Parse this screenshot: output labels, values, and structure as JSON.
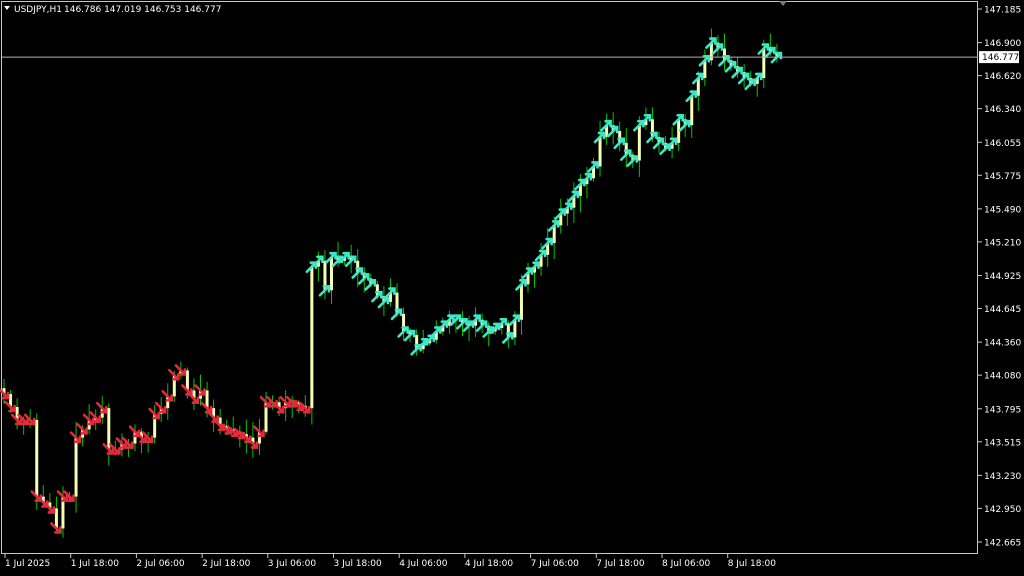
{
  "header": {
    "symbol_text": "USDJPY,H1",
    "ohlc_text": "146.786 147.019 146.753 146.777"
  },
  "colors": {
    "background": "#000000",
    "frame": "#c8c8c8",
    "text": "#ffffff",
    "candle_wick": "#00c800",
    "candle_body": "#f5ffb4",
    "up_arrow": "#3ee6c8",
    "down_arrow": "#e6283c",
    "price_line": "#b0b0b0",
    "last_price_bg": "#ffffff",
    "last_price_text": "#000000"
  },
  "chart_data": {
    "type": "candlestick",
    "symbol": "USDJPY",
    "timeframe": "H1",
    "last_price": 146.777,
    "y_ticks": [
      "147.185",
      "146.900",
      "146.620",
      "146.340",
      "146.055",
      "145.775",
      "145.490",
      "145.210",
      "144.925",
      "144.645",
      "144.360",
      "144.080",
      "143.795",
      "143.515",
      "143.230",
      "142.950",
      "142.665"
    ],
    "x_ticks": [
      "1 Jul 2025",
      "1 Jul 18:00",
      "2 Jul 06:00",
      "2 Jul 18:00",
      "3 Jul 06:00",
      "3 Jul 18:00",
      "4 Jul 06:00",
      "4 Jul 18:00",
      "7 Jul 06:00",
      "7 Jul 18:00",
      "8 Jul 06:00",
      "8 Jul 18:00"
    ],
    "ylim": [
      142.6,
      147.32
    ],
    "close_path": [
      [
        0,
        143.92
      ],
      [
        2,
        143.7
      ],
      [
        4,
        143.7
      ],
      [
        5,
        143.05
      ],
      [
        7,
        142.95
      ],
      [
        8,
        142.78
      ],
      [
        9,
        143.05
      ],
      [
        10,
        143.05
      ],
      [
        11,
        143.55
      ],
      [
        12,
        143.62
      ],
      [
        13,
        143.7
      ],
      [
        14,
        143.72
      ],
      [
        15,
        143.8
      ],
      [
        16,
        143.45
      ],
      [
        17,
        143.45
      ],
      [
        18,
        143.5
      ],
      [
        19,
        143.5
      ],
      [
        20,
        143.6
      ],
      [
        21,
        143.55
      ],
      [
        22,
        143.55
      ],
      [
        23,
        143.75
      ],
      [
        24,
        143.8
      ],
      [
        25,
        143.9
      ],
      [
        26,
        144.08
      ],
      [
        27,
        144.12
      ],
      [
        28,
        143.95
      ],
      [
        29,
        143.88
      ],
      [
        30,
        143.95
      ],
      [
        31,
        143.8
      ],
      [
        32,
        143.72
      ],
      [
        33,
        143.65
      ],
      [
        34,
        143.62
      ],
      [
        35,
        143.6
      ],
      [
        36,
        143.58
      ],
      [
        37,
        143.55
      ],
      [
        38,
        143.5
      ],
      [
        39,
        143.6
      ],
      [
        40,
        143.85
      ],
      [
        41,
        143.85
      ],
      [
        42,
        143.8
      ],
      [
        43,
        143.85
      ],
      [
        44,
        143.85
      ],
      [
        45,
        143.82
      ],
      [
        46,
        143.8
      ],
      [
        47,
        145.0
      ],
      [
        48,
        145.05
      ],
      [
        49,
        144.8
      ],
      [
        50,
        145.08
      ],
      [
        51,
        145.05
      ],
      [
        52,
        145.08
      ],
      [
        53,
        145.05
      ],
      [
        54,
        144.95
      ],
      [
        55,
        144.9
      ],
      [
        56,
        144.85
      ],
      [
        57,
        144.75
      ],
      [
        58,
        144.7
      ],
      [
        59,
        144.78
      ],
      [
        60,
        144.6
      ],
      [
        61,
        144.45
      ],
      [
        62,
        144.42
      ],
      [
        63,
        144.3
      ],
      [
        64,
        144.35
      ],
      [
        65,
        144.38
      ],
      [
        66,
        144.45
      ],
      [
        67,
        144.5
      ],
      [
        68,
        144.55
      ],
      [
        69,
        144.55
      ],
      [
        70,
        144.52
      ],
      [
        71,
        144.5
      ],
      [
        72,
        144.55
      ],
      [
        73,
        144.5
      ],
      [
        74,
        144.45
      ],
      [
        75,
        144.48
      ],
      [
        76,
        144.52
      ],
      [
        77,
        144.4
      ],
      [
        78,
        144.55
      ],
      [
        79,
        144.85
      ],
      [
        80,
        144.95
      ],
      [
        81,
        145.0
      ],
      [
        82,
        145.1
      ],
      [
        83,
        145.2
      ],
      [
        84,
        145.35
      ],
      [
        85,
        145.45
      ],
      [
        86,
        145.5
      ],
      [
        87,
        145.6
      ],
      [
        88,
        145.7
      ],
      [
        89,
        145.75
      ],
      [
        90,
        145.85
      ],
      [
        91,
        146.1
      ],
      [
        92,
        146.2
      ],
      [
        93,
        146.15
      ],
      [
        94,
        146.05
      ],
      [
        95,
        145.95
      ],
      [
        96,
        145.9
      ],
      [
        97,
        146.2
      ],
      [
        98,
        146.25
      ],
      [
        99,
        146.1
      ],
      [
        100,
        146.05
      ],
      [
        101,
        146.0
      ],
      [
        102,
        146.05
      ],
      [
        103,
        146.25
      ],
      [
        104,
        146.2
      ],
      [
        105,
        146.45
      ],
      [
        106,
        146.6
      ],
      [
        107,
        146.75
      ],
      [
        108,
        146.9
      ],
      [
        109,
        146.85
      ],
      [
        110,
        146.75
      ],
      [
        111,
        146.7
      ],
      [
        112,
        146.65
      ],
      [
        113,
        146.6
      ],
      [
        114,
        146.55
      ],
      [
        115,
        146.6
      ],
      [
        116,
        146.85
      ],
      [
        117,
        146.82
      ],
      [
        118,
        146.777
      ]
    ]
  }
}
